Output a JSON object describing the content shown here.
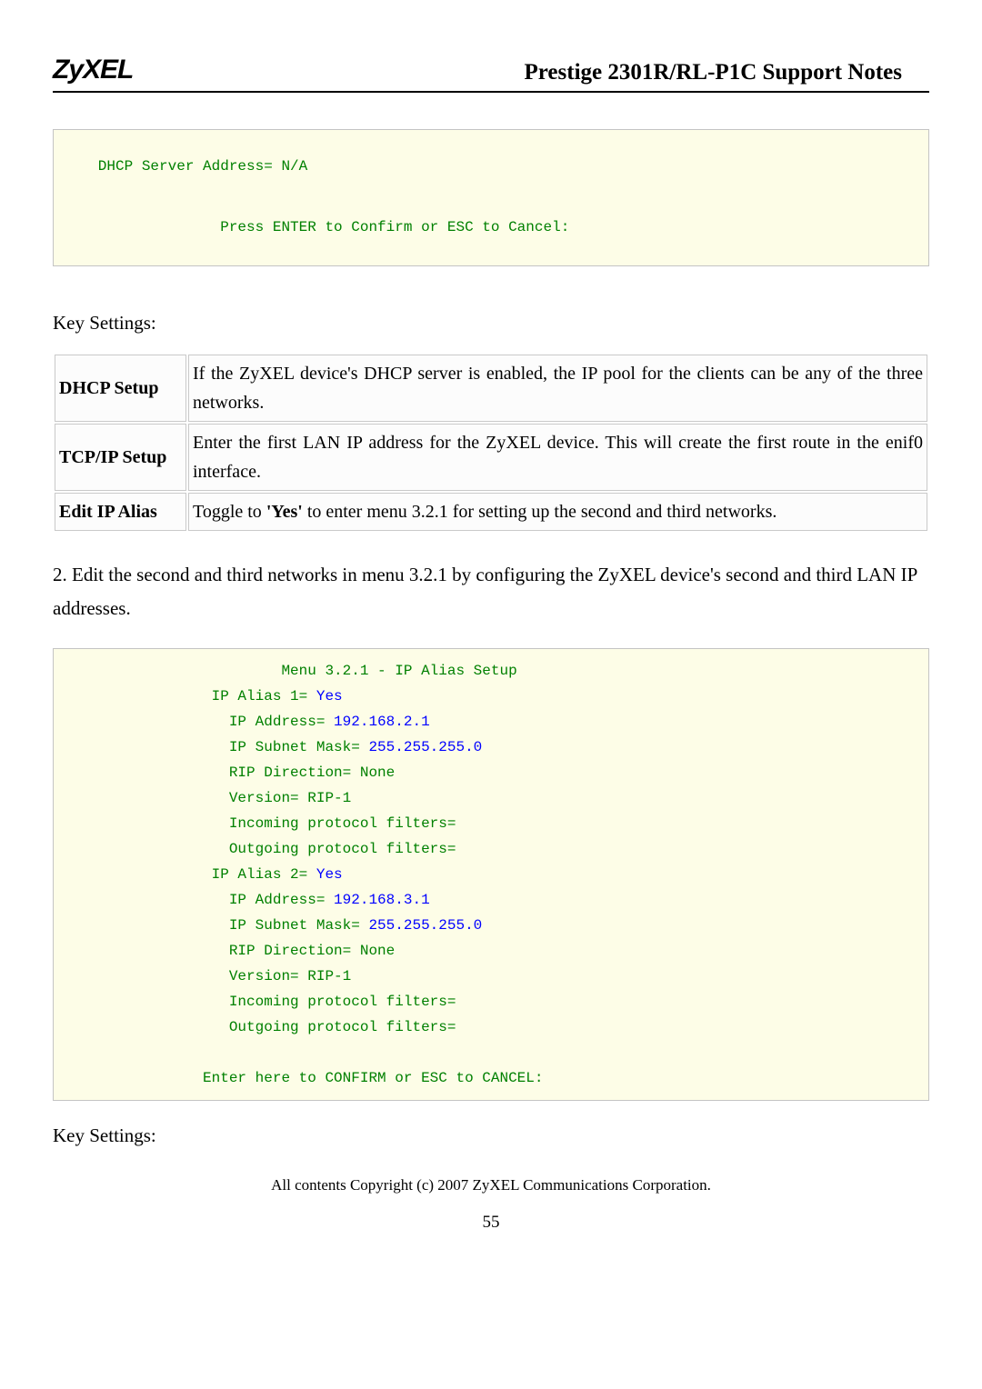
{
  "header": {
    "logo": "ZyXEL",
    "title": "Prestige 2301R/RL-P1C Support Notes"
  },
  "codebox1": {
    "line1": "   DHCP Server Address= N/A",
    "line2": "                 Press ENTER to Confirm or ESC to Cancel:"
  },
  "keySettingsLabel": "Key Settings:",
  "table1": {
    "r1label": "DHCP Setup",
    "r1desc": "If the ZyXEL device's DHCP server is enabled, the IP pool for the clients can be any of the three networks.",
    "r2label": "TCP/IP Setup",
    "r2desc": "Enter the first LAN IP address for the ZyXEL device. This will create the first route in the enif0 interface.",
    "r3label": "Edit IP Alias",
    "r3desc_pre": "Toggle to ",
    "r3desc_bold": "'Yes'",
    "r3desc_post": " to enter menu 3.2.1 for setting up the second and third networks."
  },
  "para2": "2. Edit the second and third networks in menu 3.2.1 by configuring the ZyXEL device's second and third LAN IP addresses.",
  "codebox2": {
    "l1": "                        Menu 3.2.1 - IP Alias Setup",
    "l2a": "                IP Alias 1= ",
    "l2b": "Yes",
    "l3a": "                  IP Address= ",
    "l3b": "192.168.2.1",
    "l4a": "                  IP Subnet Mask= ",
    "l4b": "255.255.255.0",
    "l5": "                  RIP Direction= None",
    "l6": "                  Version= RIP-1",
    "l7": "                  Incoming protocol filters=",
    "l8": "                  Outgoing protocol filters=",
    "l9a": "                IP Alias 2= ",
    "l9b": "Yes",
    "l10a": "                  IP Address= ",
    "l10b": "192.168.3.1",
    "l11a": "                  IP Subnet Mask= ",
    "l11b": "255.255.255.0",
    "l12": "                  RIP Direction= None",
    "l13": "                  Version= RIP-1",
    "l14": "                  Incoming protocol filters=",
    "l15": "                  Outgoing protocol filters=",
    "l16": "",
    "l17": "               Enter here to CONFIRM or ESC to CANCEL:"
  },
  "keySettingsLabel2": "Key Settings:",
  "footerCopy": "All contents Copyright (c) 2007 ZyXEL Communications Corporation.",
  "pageNum": "55"
}
